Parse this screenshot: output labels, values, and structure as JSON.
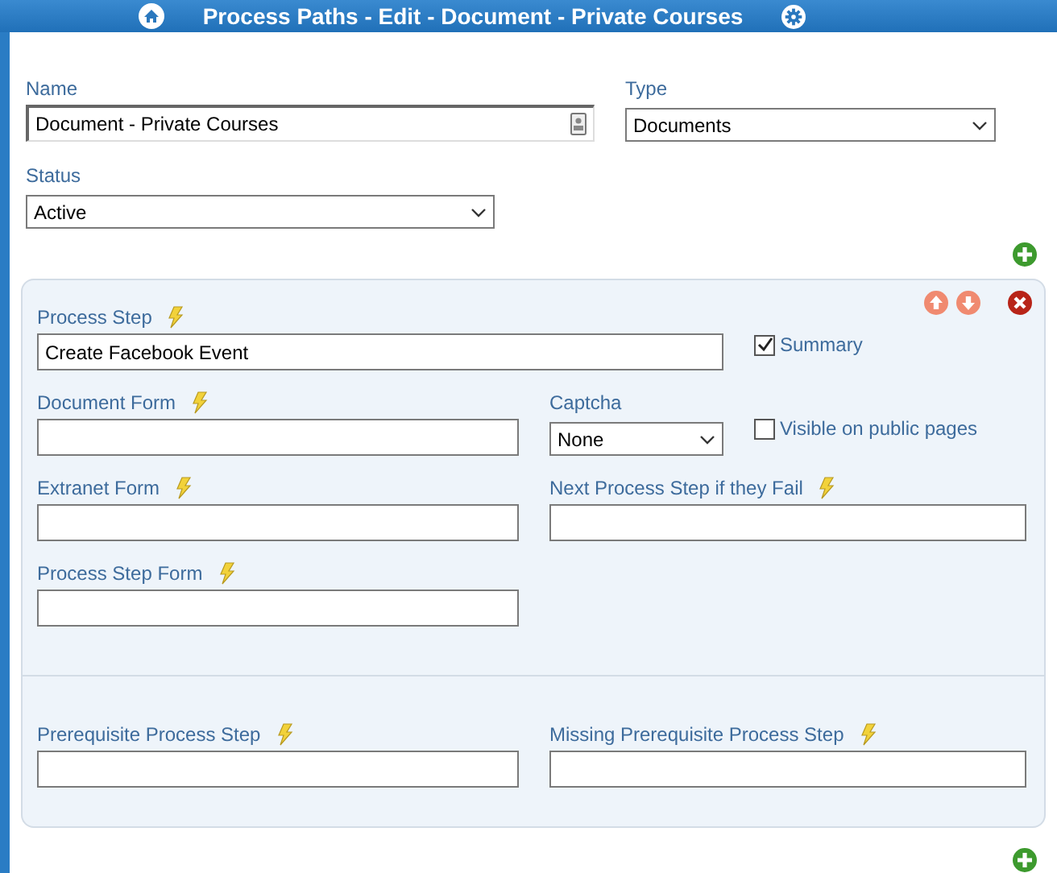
{
  "window": {
    "title": "Process Paths - Edit - Document - Private Courses"
  },
  "header_fields": [
    {
      "kind": "text",
      "label": "Name",
      "value": "Document - Private Courses"
    },
    {
      "kind": "select",
      "label": "Type",
      "value": "Documents"
    },
    {
      "kind": "select",
      "label": "Status",
      "value": "Active"
    }
  ],
  "step": {
    "rows": [
      {
        "cells": [
          {
            "kind": "text",
            "label": "Process Step",
            "lightning": true,
            "value": "Create Facebook Event"
          },
          {
            "kind": "checkbox",
            "label": "Summary",
            "checked": true
          }
        ]
      },
      {
        "cells": [
          {
            "kind": "text",
            "label": "Document Form",
            "lightning": true
          },
          {
            "kind": "select",
            "label": "Captcha",
            "lightning": false,
            "value": "None"
          },
          {
            "kind": "checkbox",
            "label": "Visible on public pages",
            "checked": false
          }
        ]
      },
      {
        "cells": [
          {
            "kind": "text",
            "label": "Extranet Form",
            "lightning": true
          },
          {
            "kind": "text",
            "label": "Next Process Step if they Fail",
            "lightning": true
          }
        ]
      },
      {
        "cells": [
          {
            "kind": "text",
            "label": "Process Step Form",
            "lightning": true
          }
        ]
      }
    ],
    "prerequisites": [
      {
        "kind": "text",
        "label": "Prerequisite Process Step",
        "lightning": true
      },
      {
        "kind": "text",
        "label": "Missing Prerequisite Process Step",
        "lightning": true
      }
    ]
  }
}
